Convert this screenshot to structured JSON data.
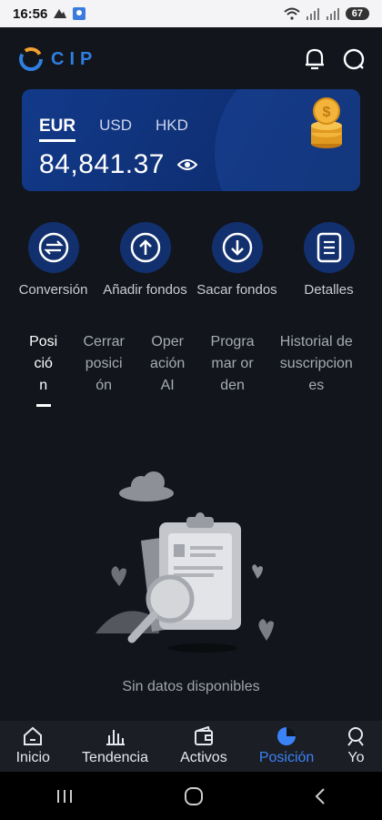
{
  "status_bar": {
    "time": "16:56",
    "battery": "67"
  },
  "header": {
    "logo_text": "CIP"
  },
  "balance": {
    "currencies": [
      "EUR",
      "USD",
      "HKD"
    ],
    "selected": "EUR",
    "amount": "84,841.37"
  },
  "actions": [
    {
      "label": "Conversión",
      "icon": "exchange-icon"
    },
    {
      "label": "Añadir fondos",
      "icon": "arrow-up-icon"
    },
    {
      "label": "Sacar fondos",
      "icon": "arrow-down-icon"
    },
    {
      "label": "Detalles",
      "icon": "document-icon"
    }
  ],
  "tabs": [
    {
      "lines": [
        "Posi",
        "ció",
        "n"
      ],
      "active": true
    },
    {
      "lines": [
        "Cerrar",
        "posici",
        "ón"
      ],
      "active": false
    },
    {
      "lines": [
        "Oper",
        "ación",
        "AI"
      ],
      "active": false
    },
    {
      "lines": [
        "Progra",
        "mar or",
        "den"
      ],
      "active": false
    },
    {
      "lines": [
        "Historial de",
        "suscripcion",
        "es"
      ],
      "active": false
    }
  ],
  "empty_state": {
    "text": "Sin datos disponibles"
  },
  "bottom_nav": [
    {
      "label": "Inicio",
      "icon": "home-icon",
      "active": false
    },
    {
      "label": "Tendencia",
      "icon": "chart-icon",
      "active": false
    },
    {
      "label": "Activos",
      "icon": "wallet-icon",
      "active": false
    },
    {
      "label": "Posición",
      "icon": "pie-chart-icon",
      "active": true
    },
    {
      "label": "Yo",
      "icon": "profile-icon",
      "active": false
    }
  ],
  "colors": {
    "background": "#12151c",
    "accent": "#3b82f6",
    "card": "#123a8a",
    "action_circle": "#13306e"
  }
}
